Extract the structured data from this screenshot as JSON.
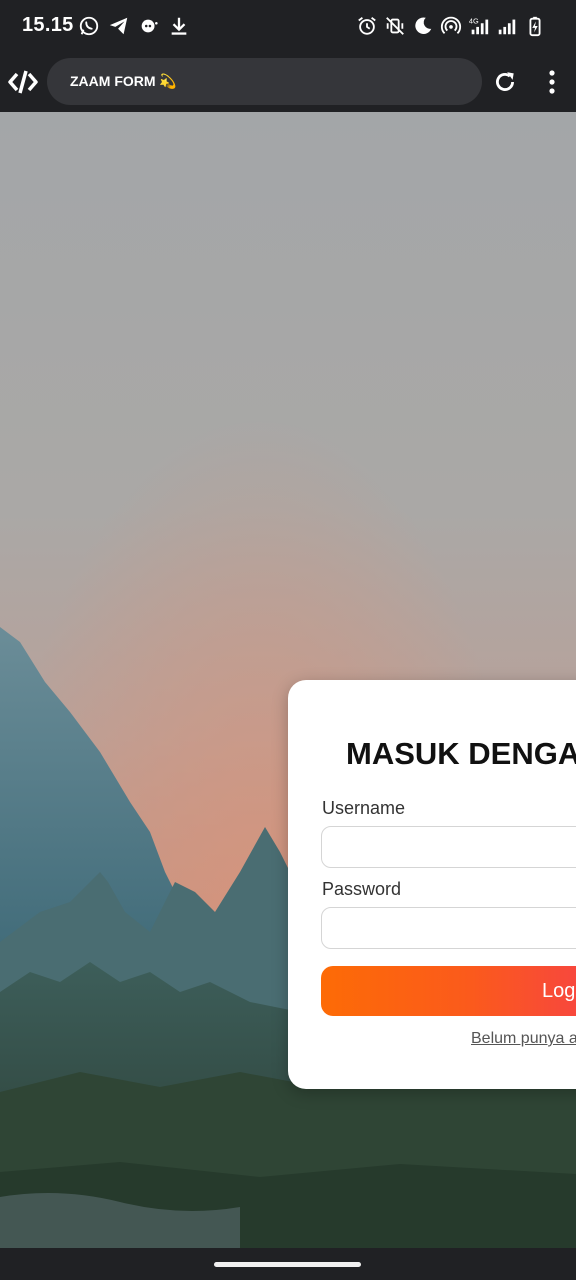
{
  "status_bar": {
    "time": "15.15",
    "left_icons": [
      "whatsapp-icon",
      "telegram-icon",
      "chat-bubble-icon",
      "download-icon"
    ],
    "right_icons": [
      "alarm-icon",
      "vibrate-off-icon",
      "dnd-moon-icon",
      "hotspot-icon",
      "signal-4g-icon",
      "signal-icon",
      "battery-charging-icon"
    ]
  },
  "browser": {
    "site_icon": "code-brackets-icon",
    "url_title": "ZAAM FORM 💫",
    "actions": [
      "reload-icon",
      "more-vert-icon"
    ]
  },
  "background": {
    "description_icon": "mountain-forest-landscape"
  },
  "login_card": {
    "title": "MASUK DENGAN",
    "username_label": "Username",
    "username_value": "",
    "password_label": "Password",
    "password_value": "",
    "login_button": "Login",
    "register_link": "Belum punya a"
  },
  "colors": {
    "system_bar": "#202124",
    "url_pill": "#35363a",
    "button_gradient_start": "#fd6b06",
    "button_gradient_end": "#f6404a",
    "card": "#ffffff"
  }
}
